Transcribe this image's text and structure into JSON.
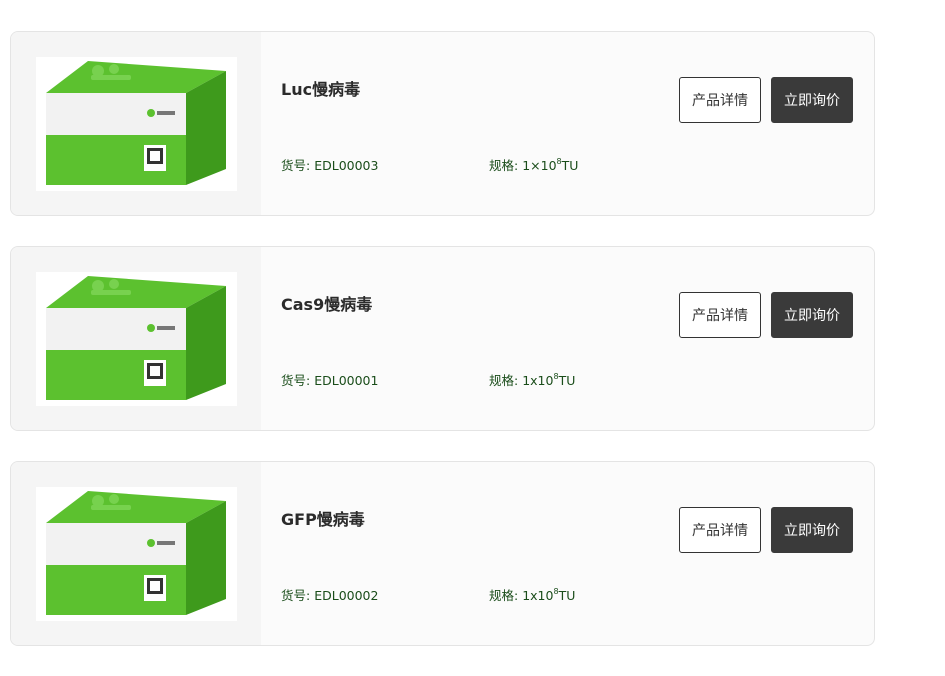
{
  "products": [
    {
      "name": "Luc慢病毒",
      "code_label": "货号:",
      "code": "EDL00003",
      "spec_label": "规格:",
      "spec_base": "1×10",
      "spec_exp": "8",
      "spec_unit": "TU",
      "detail_label": "产品详情",
      "inquiry_label": "立即询价"
    },
    {
      "name": "Cas9慢病毒",
      "code_label": "货号:",
      "code": "EDL00001",
      "spec_label": "规格:",
      "spec_base": "1x10",
      "spec_exp": "8",
      "spec_unit": "TU",
      "detail_label": "产品详情",
      "inquiry_label": "立即询价"
    },
    {
      "name": "GFP慢病毒",
      "code_label": "货号:",
      "code": "EDL00002",
      "spec_label": "规格:",
      "spec_base": "1x10",
      "spec_exp": "8",
      "spec_unit": "TU",
      "detail_label": "产品详情",
      "inquiry_label": "立即询价"
    }
  ],
  "colors": {
    "box_green": "#5cc12f",
    "box_dark_green": "#3e9a1c",
    "button_dark": "#3a3a3a",
    "meta_text": "#1a4d1a"
  },
  "icons": {
    "product_image": "product-box-image"
  }
}
